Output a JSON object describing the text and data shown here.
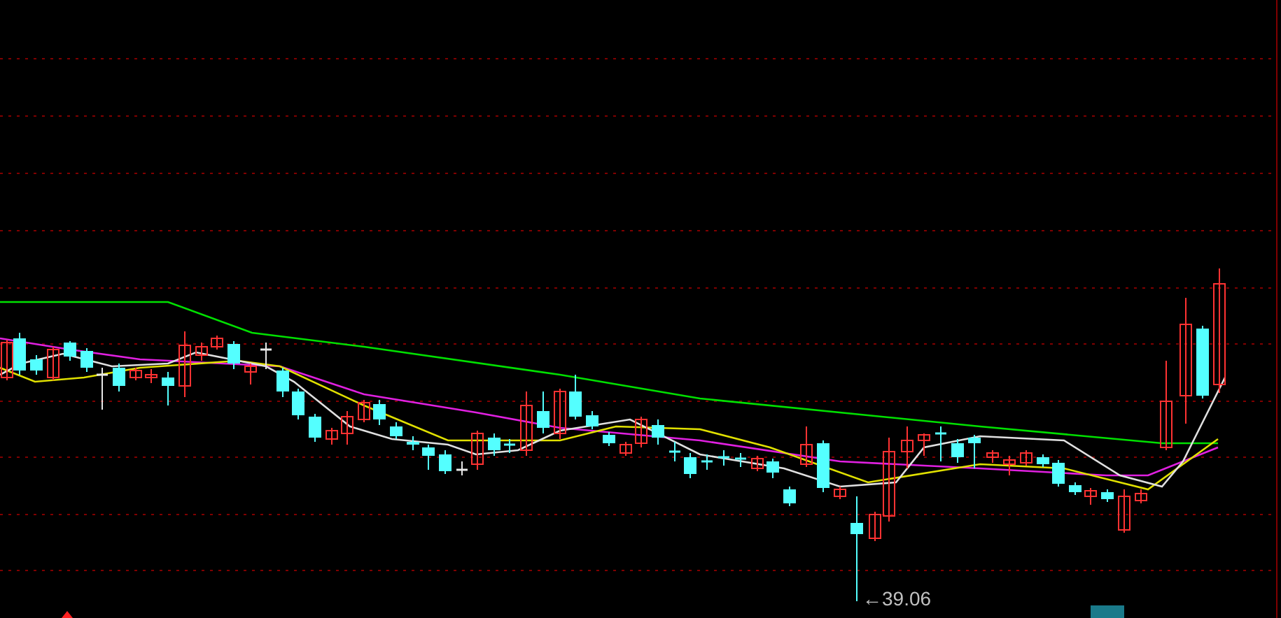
{
  "chart": {
    "low_marker_label": "←39.06"
  }
}
